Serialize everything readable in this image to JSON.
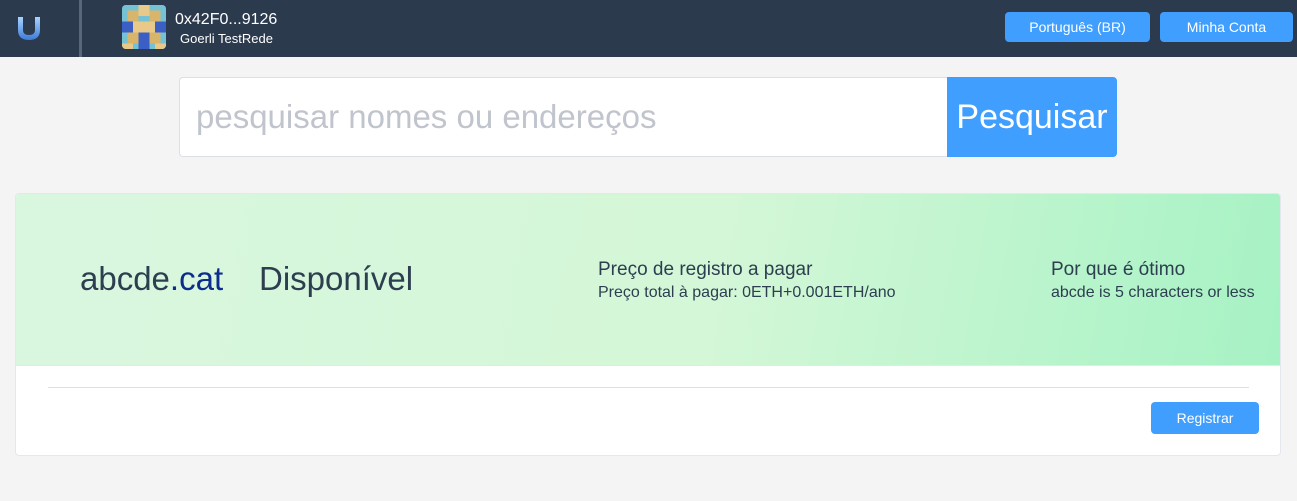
{
  "header": {
    "logo_icon": "u-logo-icon",
    "account": {
      "address": "0x42F0...9126",
      "network": "Goerli TestRede"
    },
    "language_button": "Português (BR)",
    "account_button": "Minha Conta"
  },
  "search": {
    "placeholder": "pesquisar nomes ou endereços",
    "value": "",
    "button_label": "Pesquisar"
  },
  "result": {
    "name": "abcde",
    "tld": ".cat",
    "status": "Disponível",
    "price_title": "Preço de registro a pagar",
    "price_total": "Preço total à pagar:  0ETH+0.001ETH/ano",
    "why_title": "Por que é ótimo",
    "why_text": "abcde is 5 characters or less",
    "register_button": "Registrar"
  },
  "colors": {
    "header_bg": "#2c3a4e",
    "accent": "#409eff",
    "tld": "#0d2c8c"
  }
}
